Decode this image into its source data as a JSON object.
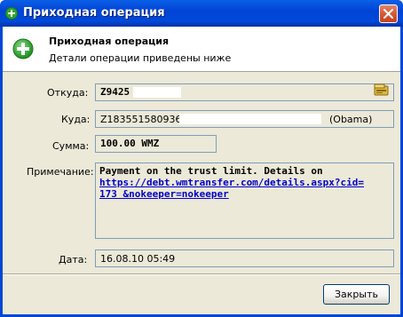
{
  "window": {
    "title": "Приходная операция"
  },
  "header": {
    "title": "Приходная операция",
    "subtitle": "Детали операции приведены ниже"
  },
  "form": {
    "from_label": "Откуда:",
    "from_value": "Z9425",
    "to_label": "Куда:",
    "to_value_prefix": "Z183551580936,",
    "to_value_suffix": "(Obama)",
    "amount_label": "Сумма:",
    "amount_value": "100.00 WMZ",
    "note_label": "Примечание:",
    "note_text": "Payment on the trust limit. Details on",
    "note_link": "https://debt.wmtransfer.com/details.aspx?cid=173 &nokeeper=nokeeper",
    "note_link_line1": "https://debt.wmtransfer.com/details.aspx?cid=",
    "note_link_line2": "173 &nokeeper=nokeeper",
    "date_label": "Дата:",
    "date_value": "16.08.10 05:49"
  },
  "buttons": {
    "close_label": "Закрыть"
  },
  "icons": {
    "title_icon": "add-circle-icon",
    "header_icon": "add-circle-icon",
    "from_wallet_icon": "wallet-icon",
    "window_close": "close-icon"
  },
  "colors": {
    "titlebar": "#0049d9",
    "dialog_bg": "#ece9d8",
    "field_border": "#7f9db9",
    "link": "#0000cc",
    "icon_green": "#2fa52f"
  }
}
